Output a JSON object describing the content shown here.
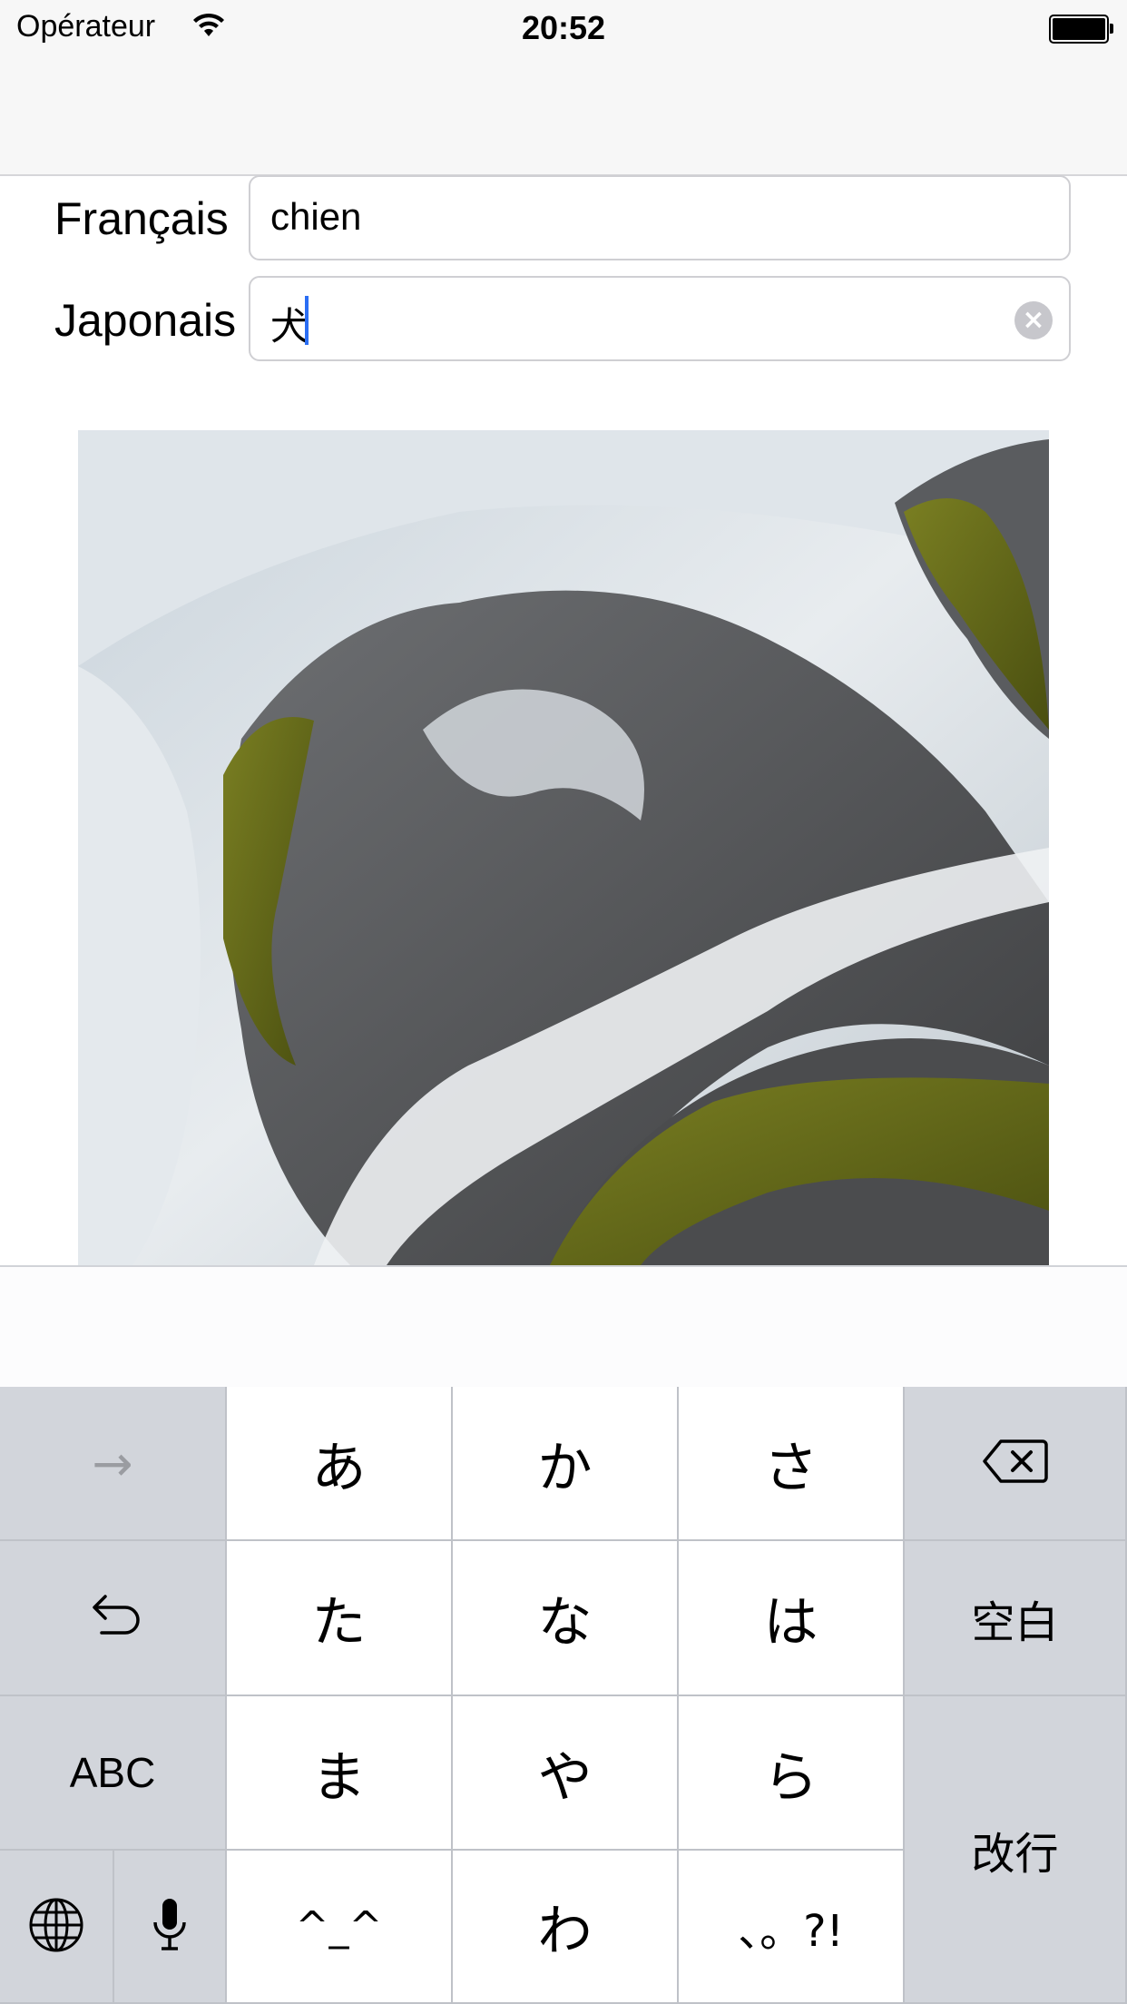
{
  "status_bar": {
    "carrier": "Opérateur",
    "time": "20:52"
  },
  "form": {
    "french_label": "Français",
    "french_value": "chien",
    "japanese_label": "Japonais",
    "japanese_value": "犬"
  },
  "keyboard": {
    "row1": [
      "→",
      "あ",
      "か",
      "さ",
      "⌫"
    ],
    "row2": [
      "↺",
      "た",
      "な",
      "は",
      "空白"
    ],
    "row3": [
      "ABC",
      "ま",
      "や",
      "ら"
    ],
    "row4": [
      "^_^",
      "わ",
      "、。?!"
    ],
    "enter": "改行"
  },
  "icons": [
    "wifi-icon",
    "battery-icon",
    "clear-icon",
    "arrow-right-icon",
    "delete-icon",
    "undo-icon",
    "globe-icon",
    "microphone-icon"
  ]
}
